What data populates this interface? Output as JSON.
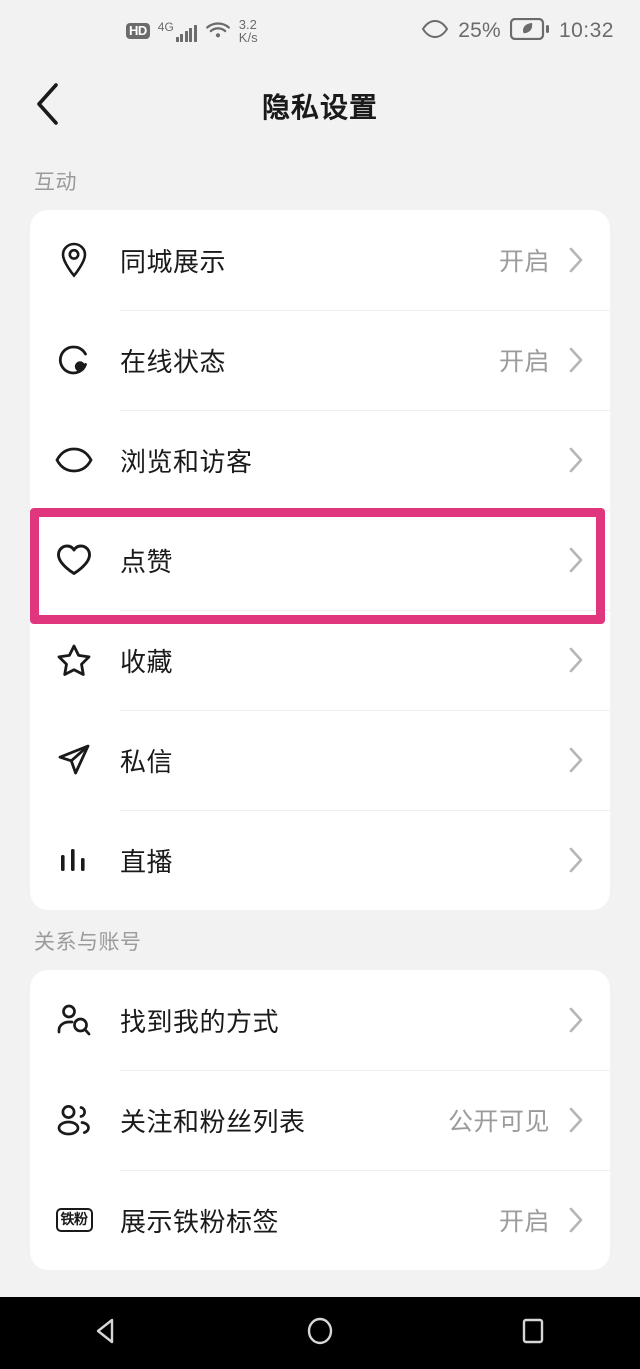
{
  "statusbar": {
    "hd_label": "HD",
    "network_type": "4G",
    "net_speed_value": "3.2",
    "net_speed_unit": "K/s",
    "battery_percent": "25%",
    "clock": "10:32"
  },
  "header": {
    "title": "隐私设置",
    "back_icon": "chevron-left-icon"
  },
  "accent_color": "#e0367e",
  "sections": [
    {
      "label": "互动",
      "items": [
        {
          "icon": "location-pin-icon",
          "label": "同城展示",
          "value": "开启"
        },
        {
          "icon": "online-status-icon",
          "label": "在线状态",
          "value": "开启"
        },
        {
          "icon": "eye-icon",
          "label": "浏览和访客",
          "value": ""
        },
        {
          "icon": "heart-icon",
          "label": "点赞",
          "value": "",
          "highlighted": true
        },
        {
          "icon": "star-icon",
          "label": "收藏",
          "value": ""
        },
        {
          "icon": "paper-plane-icon",
          "label": "私信",
          "value": ""
        },
        {
          "icon": "live-bars-icon",
          "label": "直播",
          "value": ""
        }
      ]
    },
    {
      "label": "关系与账号",
      "items": [
        {
          "icon": "person-search-icon",
          "label": "找到我的方式",
          "value": ""
        },
        {
          "icon": "people-group-icon",
          "label": "关注和粉丝列表",
          "value": "公开可见"
        },
        {
          "icon": "tiefen-badge-icon",
          "icon_text": "铁粉",
          "label": "展示铁粉标签",
          "value": "开启"
        }
      ]
    }
  ],
  "android_nav": {
    "back": "triangle-back-icon",
    "home": "circle-home-icon",
    "recents": "square-recents-icon"
  }
}
